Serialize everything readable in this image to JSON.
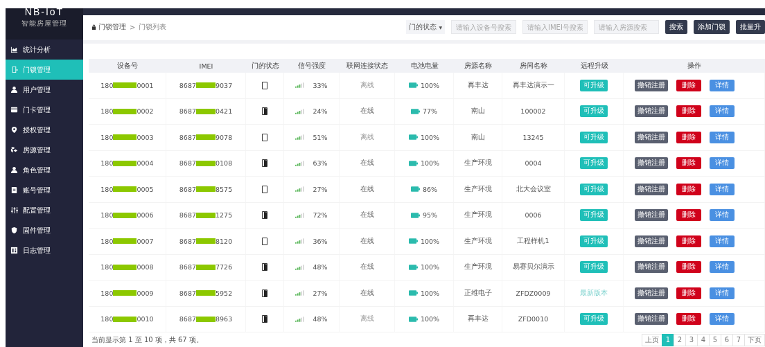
{
  "logo": {
    "title": "NB-IoT",
    "subtitle": "智能房屋管理"
  },
  "sidebar": {
    "items": [
      {
        "label": "统计分析",
        "selected": false
      },
      {
        "label": "门锁管理",
        "selected": true
      },
      {
        "label": "用户管理",
        "selected": false
      },
      {
        "label": "门卡管理",
        "selected": false
      },
      {
        "label": "授权管理",
        "selected": false
      },
      {
        "label": "房源管理",
        "selected": false
      },
      {
        "label": "角色管理",
        "selected": false
      },
      {
        "label": "账号管理",
        "selected": false
      },
      {
        "label": "配置管理",
        "selected": false
      },
      {
        "label": "固件管理",
        "selected": false
      },
      {
        "label": "日志管理",
        "selected": false
      }
    ]
  },
  "breadcrumb": [
    "门锁管理",
    ">",
    "门锁列表"
  ],
  "filters": {
    "select": {
      "value": "门的状态",
      "caret": "▼"
    },
    "inputs": [
      {
        "placeholder": "请输入设备号搜索"
      },
      {
        "placeholder": "请输入IMEI号搜索"
      },
      {
        "placeholder": "请输入房源搜索"
      }
    ],
    "buttons": [
      "搜索",
      "添加门锁",
      "批量升"
    ]
  },
  "table": {
    "columns": [
      "设备号",
      "IMEI",
      "门的状态",
      "信号强度",
      "联网连接状态",
      "电池电量",
      "房源名称",
      "房间名称",
      "远程升级",
      "操作"
    ],
    "rows": [
      {
        "id_start": "180",
        "id_end": "0001",
        "imei_start": "8687",
        "imei_end": "9037",
        "door_open": false,
        "signal": "33%",
        "online": false,
        "status": "离线",
        "battery": "100%",
        "source": "再丰达",
        "room": "再丰达演示一",
        "upgrade": {
          "kind": "button",
          "label": "可升级"
        },
        "actions": [
          "撤销注册",
          "删除",
          "详情"
        ]
      },
      {
        "id_start": "180",
        "id_end": "0002",
        "imei_start": "8687",
        "imei_end": "0421",
        "door_open": true,
        "signal": "24%",
        "online": true,
        "status": "在线",
        "battery": "77%",
        "source": "南山",
        "room": "100002",
        "upgrade": {
          "kind": "button",
          "label": "可升级"
        },
        "actions": [
          "撤销注册",
          "删除",
          "详情"
        ]
      },
      {
        "id_start": "180",
        "id_end": "0003",
        "imei_start": "8687",
        "imei_end": "9078",
        "door_open": false,
        "signal": "51%",
        "online": false,
        "status": "离线",
        "battery": "100%",
        "source": "南山",
        "room": "13245",
        "upgrade": {
          "kind": "button",
          "label": "可升级"
        },
        "actions": [
          "撤销注册",
          "删除",
          "详情"
        ]
      },
      {
        "id_start": "180",
        "id_end": "0004",
        "imei_start": "8687",
        "imei_end": "0108",
        "door_open": true,
        "signal": "63%",
        "online": true,
        "status": "在线",
        "battery": "100%",
        "source": "生产环境",
        "room": "0004",
        "upgrade": {
          "kind": "button",
          "label": "可升级"
        },
        "actions": [
          "撤销注册",
          "删除",
          "详情"
        ]
      },
      {
        "id_start": "180",
        "id_end": "0005",
        "imei_start": "8687",
        "imei_end": "8575",
        "door_open": false,
        "signal": "27%",
        "online": true,
        "status": "在线",
        "battery": "86%",
        "source": "生产环境",
        "room": "北大会议室",
        "upgrade": {
          "kind": "button",
          "label": "可升级"
        },
        "actions": [
          "撤销注册",
          "删除",
          "详情"
        ]
      },
      {
        "id_start": "180",
        "id_end": "0006",
        "imei_start": "8687",
        "imei_end": "1275",
        "door_open": true,
        "signal": "72%",
        "online": true,
        "status": "在线",
        "battery": "95%",
        "source": "生产环境",
        "room": "0006",
        "upgrade": {
          "kind": "button",
          "label": "可升级"
        },
        "actions": [
          "撤销注册",
          "删除",
          "详情"
        ]
      },
      {
        "id_start": "180",
        "id_end": "0007",
        "imei_start": "8687",
        "imei_end": "8120",
        "door_open": false,
        "signal": "36%",
        "online": true,
        "status": "在线",
        "battery": "100%",
        "source": "生产环境",
        "room": "工程样机1",
        "upgrade": {
          "kind": "button",
          "label": "可升级"
        },
        "actions": [
          "撤销注册",
          "删除",
          "详情"
        ]
      },
      {
        "id_start": "180",
        "id_end": "0008",
        "imei_start": "8687",
        "imei_end": "7726",
        "door_open": true,
        "signal": "48%",
        "online": true,
        "status": "在线",
        "battery": "100%",
        "source": "生产环境",
        "room": "易赛贝尔演示",
        "upgrade": {
          "kind": "button",
          "label": "可升级"
        },
        "actions": [
          "撤销注册",
          "删除",
          "详情"
        ]
      },
      {
        "id_start": "180",
        "id_end": "0009",
        "imei_start": "8687",
        "imei_end": "5952",
        "door_open": true,
        "signal": "27%",
        "online": true,
        "status": "在线",
        "battery": "100%",
        "source": "正维电子",
        "room": "ZFDZ0009",
        "upgrade": {
          "kind": "text",
          "label": "最新版本"
        },
        "actions": [
          "撤销注册",
          "删除",
          "详情"
        ]
      },
      {
        "id_start": "180",
        "id_end": "0010",
        "imei_start": "8687",
        "imei_end": "8963",
        "door_open": true,
        "signal": "48%",
        "online": false,
        "status": "离线",
        "battery": "100%",
        "source": "再丰达",
        "room": "ZFD0010",
        "upgrade": {
          "kind": "button",
          "label": "可升级"
        },
        "actions": [
          "撤销注册",
          "删除",
          "详情"
        ]
      }
    ]
  },
  "footer": {
    "summary": "当前显示第 1 至 10 项，共 67 项。"
  },
  "pagination": [
    {
      "label": "上页",
      "selected": false
    },
    {
      "label": "1",
      "selected": true
    },
    {
      "label": "2",
      "selected": false
    },
    {
      "label": "3",
      "selected": false
    },
    {
      "label": "4",
      "selected": false
    },
    {
      "label": "5",
      "selected": false
    },
    {
      "label": "6",
      "selected": false
    },
    {
      "label": "7",
      "selected": false
    },
    {
      "label": "下页",
      "selected": false
    }
  ]
}
